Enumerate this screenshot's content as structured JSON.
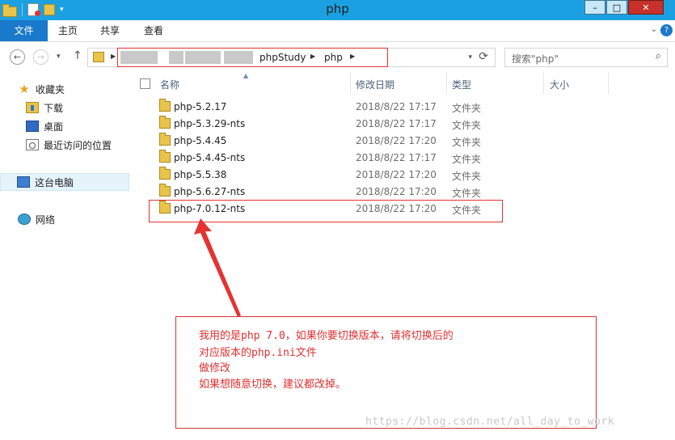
{
  "window": {
    "title": "php",
    "minimize_label": "–",
    "maximize_label": "□",
    "close_label": "✕"
  },
  "ribbon": {
    "tabs": [
      {
        "label": "文件"
      },
      {
        "label": "主页"
      },
      {
        "label": "共享"
      },
      {
        "label": "查看"
      }
    ],
    "help_label": "?"
  },
  "address_bar": {
    "breadcrumbs": [
      "phpStudy",
      "php"
    ],
    "search_placeholder": "搜索\"php\""
  },
  "nav_pane": {
    "items": [
      {
        "label": "收藏夹",
        "icon": "star-icon"
      },
      {
        "label": "下载",
        "icon": "downloads-folder-icon"
      },
      {
        "label": "桌面",
        "icon": "desktop-icon"
      },
      {
        "label": "最近访问的位置",
        "icon": "recent-places-icon"
      },
      {
        "label": "这台电脑",
        "icon": "computer-icon"
      },
      {
        "label": "网络",
        "icon": "network-icon"
      }
    ]
  },
  "columns": {
    "name": "名称",
    "modified": "修改日期",
    "type": "类型",
    "size": "大小"
  },
  "files": [
    {
      "name": "php-5.2.17",
      "modified": "2018/8/22 17:17",
      "type": "文件夹"
    },
    {
      "name": "php-5.3.29-nts",
      "modified": "2018/8/22 17:17",
      "type": "文件夹"
    },
    {
      "name": "php-5.4.45",
      "modified": "2018/8/22 17:20",
      "type": "文件夹"
    },
    {
      "name": "php-5.4.45-nts",
      "modified": "2018/8/22 17:17",
      "type": "文件夹"
    },
    {
      "name": "php-5.5.38",
      "modified": "2018/8/22 17:20",
      "type": "文件夹"
    },
    {
      "name": "php-5.6.27-nts",
      "modified": "2018/8/22 17:20",
      "type": "文件夹"
    },
    {
      "name": "php-7.0.12-nts",
      "modified": "2018/8/22 17:20",
      "type": "文件夹"
    }
  ],
  "annotation": {
    "lines": [
      "我用的是php 7.0，如果你要切换版本，请将切换后的",
      "对应版本的php.ini文件",
      "做修改",
      "如果想随意切换，建议都改掉。"
    ],
    "color": "#e03030"
  },
  "watermark": "https://blog.csdn.net/all_day_to_work",
  "colors": {
    "titlebar": "#1ba1e2",
    "file_tab": "#1979ca",
    "highlight_box": "#e53333"
  }
}
